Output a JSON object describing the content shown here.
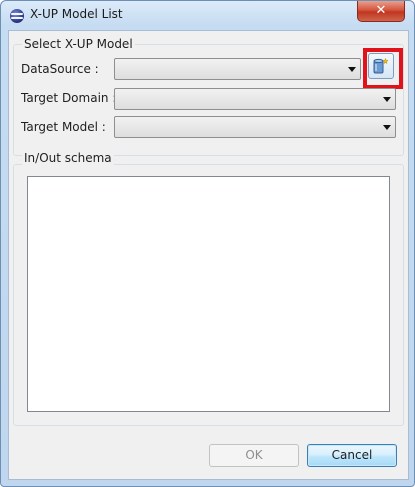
{
  "window": {
    "title": "X-UP Model List",
    "close_label": "✕"
  },
  "select_group": {
    "title": "Select X-UP Model",
    "datasource": {
      "label": "DataSource :",
      "value": ""
    },
    "target_domain": {
      "label": "Target Domain :",
      "value": ""
    },
    "target_model": {
      "label": "Target Model :",
      "value": ""
    },
    "datasource_button_icon": "database-add-icon"
  },
  "io_group": {
    "title": "In/Out schema",
    "schema_text": ""
  },
  "buttons": {
    "ok": "OK",
    "cancel": "Cancel"
  },
  "colors": {
    "highlight": "#e0131b",
    "close_button": "#c0361f"
  }
}
